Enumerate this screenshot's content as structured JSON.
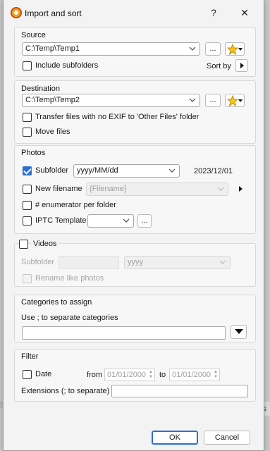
{
  "window": {
    "title": "Import and sort",
    "help_label": "?",
    "close_label": "✕"
  },
  "source": {
    "label": "Source",
    "path": "C:\\Temp\\Temp1",
    "browse_label": "...",
    "include_subfolders_label": "Include subfolders",
    "include_subfolders_checked": false,
    "sort_by_label": "Sort by"
  },
  "destination": {
    "label": "Destination",
    "path": "C:\\Temp\\Temp2",
    "browse_label": "...",
    "transfer_label": "Transfer files with no EXIF to 'Other Files' folder",
    "transfer_checked": false,
    "move_label": "Move files",
    "move_checked": false
  },
  "photos": {
    "label": "Photos",
    "subfolder_label": "Subfolder",
    "subfolder_checked": true,
    "subfolder_format": "yyyy/MM/dd",
    "subfolder_preview": "2023/12/01",
    "new_filename_label": "New filename",
    "new_filename_checked": false,
    "new_filename_value": "{Filename}",
    "enumerator_label": "# enumerator per folder",
    "enumerator_checked": false,
    "iptc_label": "IPTC Template",
    "iptc_checked": false,
    "iptc_value": "",
    "iptc_browse_label": "..."
  },
  "videos": {
    "label": "Videos",
    "checked": false,
    "subfolder_label": "Subfolder",
    "subfolder_format": "yyyy",
    "rename_like_photos_label": "Rename like photos"
  },
  "categories": {
    "label": "Categories to assign",
    "hint": "Use ; to separate categories",
    "value": ""
  },
  "filter": {
    "label": "Filter",
    "date_label": "Date",
    "date_checked": false,
    "from_label": "from",
    "from_value": "01/01/2000",
    "to_label": "to",
    "to_value": "01/01/2000",
    "extensions_label": "Extensions (; to separate)",
    "extensions_value": ""
  },
  "footer": {
    "ok_label": "OK",
    "cancel_label": "Cancel"
  },
  "background": {
    "partial_text": "ts"
  },
  "colors": {
    "accent": "#2b6fd6",
    "star": "#f5c518"
  }
}
